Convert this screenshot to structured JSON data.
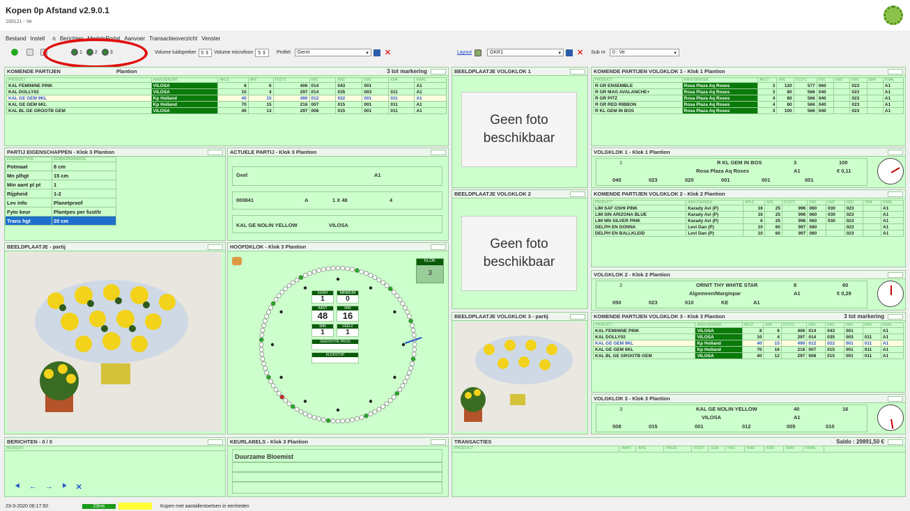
{
  "app": {
    "title": "Kopen 0p Afstand v2.9.0.1",
    "subtitle": "100121 - Ve"
  },
  "menu": [
    "Bestand",
    "Instell",
    "n",
    "Berichten",
    "ModelsPortal",
    "Aanvoer",
    "Transactieoverzicht",
    "Venster"
  ],
  "toolbar": {
    "clock1": "1",
    "clock2": "2",
    "clock3": "3",
    "volume_speaker_label": "Volume luidspreker",
    "volume_speaker": "5",
    "volume_mic_label": "Volume microfoon",
    "volume_mic": "5",
    "profile_label": "Profiel",
    "profile": "Gernt",
    "layout_label": "Layout",
    "layout": "GKR1",
    "sub_label": "Sub nr",
    "sub": "0 : Ve"
  },
  "komende3": {
    "title": "KOMENDE PARTIJEN",
    "title_suffix": "Plantion",
    "marker": "3 tot markering",
    "headers": [
      "PRODUCT",
      "AANVOERDER",
      "APLD",
      "APE",
      "FUSTC",
      "KM1",
      "KM2",
      "KM3",
      "KM4",
      "KWAL"
    ],
    "rows": [
      [
        "KAL FEMININE PINK",
        "VILOSA",
        "8",
        "6",
        "406",
        "014",
        "043",
        "001",
        "",
        "A1"
      ],
      [
        "KAL DOLLY02",
        "VILOSA",
        "10",
        "4",
        "297",
        "014",
        "035",
        "003",
        "011",
        "A1"
      ],
      [
        "KAL GE GEM 9KL",
        "Kp Holland",
        "40",
        "15",
        "490",
        "012",
        "022",
        "001",
        "011",
        "A1"
      ],
      [
        "KAL GE GEM 6KL",
        "Kp Holland",
        "70",
        "15",
        "216",
        "007",
        "015",
        "001",
        "011",
        "A1"
      ],
      [
        "KAL BL GE GROOTB GEM",
        "VILOSA",
        "40",
        "13",
        "297",
        "008",
        "015",
        "001",
        "011",
        "A1"
      ]
    ]
  },
  "beeld1": {
    "title": "BEELDPLAATJE VOLGKLOK 1",
    "text": "Geen foto beschikbaar"
  },
  "beeld2": {
    "title": "BEELDPLAATJE VOLGKLOK 2",
    "text": "Geen foto beschikbaar"
  },
  "beeld3": {
    "title": "BEELDPLAATJE VOLGKLOK 3 - partij"
  },
  "komende1": {
    "title": "KOMENDE PARTIJEN VOLGKLOK 1 - Klok 1 Plantion",
    "headers": [
      "PRODUCT",
      "AANVOERDER",
      "APLD",
      "APE",
      "FUSTC",
      "KM1",
      "KM2",
      "KM3",
      "KM4",
      "KWAL"
    ],
    "rows": [
      [
        "R GR ENSEMBLE",
        "Rosa Plaza Aq Roses",
        "3",
        "120",
        "577",
        "060",
        "",
        "023",
        "",
        "A1"
      ],
      [
        "R GR MAG AVALANCHE+",
        "Rosa Plaza Aq Roses",
        "3",
        "80",
        "566",
        "040",
        "",
        "023",
        "",
        "A1"
      ],
      [
        "R GR PITZ",
        "Rosa Plaza Aq Roses",
        "4",
        "80",
        "566",
        "040",
        "",
        "023",
        "",
        "A1"
      ],
      [
        "R GR RED RIBBON",
        "Rosa Plaza Aq Roses",
        "4",
        "80",
        "566",
        "040",
        "",
        "023",
        "",
        "A1"
      ],
      [
        "R KL GEM IN BOS",
        "Rosa Plaza Aq Roses",
        "3",
        "100",
        "566",
        "040",
        "",
        "023",
        "",
        "A1"
      ]
    ]
  },
  "volg1": {
    "title": "VOLGKLOK 1 - Klok 1 Plantion",
    "nr": "1",
    "product": "R KL GEM IN BOS",
    "aanvoerder": "Rosa Plaza Aq Roses",
    "v1": "3",
    "v2": "100",
    "kwal": "A1",
    "prijs": "€ 0,11",
    "c1": "040",
    "c2": "023",
    "c3": "020",
    "c4": "001",
    "c5": "001",
    "c6": "001"
  },
  "komende2": {
    "title": "KOMENDE PARTIJEN VOLGKLOK 2 - Klok 2 Plantion",
    "headers": [
      "PRODUCT",
      "AANVOERDER",
      "APLD",
      "APE",
      "FUSTC",
      "KM1",
      "KM2",
      "KM3",
      "KM4",
      "KWAL"
    ],
    "rows": [
      [
        "LIM SAF OSHI PINK",
        "Karady Avi (P)",
        "16",
        "25",
        "996",
        "060",
        "030",
        "023",
        "",
        "A1"
      ],
      [
        "LIM SIN ARIZONA BLUE",
        "Karady Avi (P)",
        "16",
        "25",
        "996",
        "060",
        "030",
        "023",
        "",
        "A1"
      ],
      [
        "LIM MN SILVER PINK",
        "Karady Avi (P)",
        "6",
        "25",
        "996",
        "060",
        "030",
        "023",
        "",
        "A1"
      ],
      [
        "DELPH EN DONNA",
        "Levi Dan (P)",
        "10",
        "60",
        "997",
        "080",
        "",
        "023",
        "",
        "A1"
      ],
      [
        "DELPH EN BALLKLEID",
        "Levi Dan (P)",
        "10",
        "60",
        "997",
        "080",
        "",
        "023",
        "",
        "A1"
      ]
    ]
  },
  "volg2": {
    "title": "VOLGKLOK 2 - Klok 2 Plantion",
    "nr": "2",
    "product": "ORNIT THY WHITE STAR",
    "aanvoerder": "Algemeen/Marginpar",
    "v1": "8",
    "v2": "60",
    "kwal": "A1",
    "prijs": "€ 0,29",
    "c1": "050",
    "c2": "023",
    "c3": "010",
    "c4": "KE",
    "c5": "A1"
  },
  "komende3b": {
    "title": "KOMENDE PARTIJEN VOLGKLOK 3 - Klok 3 Plantion",
    "marker": "3 tot markering",
    "headers": [
      "PRODUCT",
      "AANVOERDER",
      "APLD",
      "APE",
      "FUSTC",
      "KM1",
      "KM2",
      "KM3",
      "KM4",
      "KWAL"
    ],
    "rows": [
      [
        "KAL FEMININE PINK",
        "VILOSA",
        "8",
        "6",
        "406",
        "014",
        "043",
        "001",
        "",
        "A1"
      ],
      [
        "KAL DOLLY02",
        "VILOSA",
        "10",
        "4",
        "297",
        "014",
        "035",
        "003",
        "011",
        "A1"
      ],
      [
        "KAL GE GEM 9KL",
        "Kp Holland",
        "40",
        "15",
        "490",
        "012",
        "022",
        "001",
        "011",
        "A1"
      ],
      [
        "KAL GE GEM 6KL",
        "Kp Holland",
        "70",
        "16",
        "216",
        "007",
        "015",
        "001",
        "011",
        "A1"
      ],
      [
        "KAL BL GE GROOTB GEM",
        "VILOSA",
        "40",
        "12",
        "297",
        "008",
        "015",
        "001",
        "011",
        "A1"
      ]
    ]
  },
  "volg3": {
    "title": "VOLGKLOK 3 - Klok 3 Plantion",
    "nr": "3",
    "product": "KAL GE NOLIN YELLOW",
    "aanvoerder": "VILOSA",
    "v1": "40",
    "v2": "16",
    "kwal": "A1",
    "c1": "008",
    "c2": "015",
    "c3": "001",
    "c4": "012",
    "c5": "005",
    "c6": "010"
  },
  "eigen": {
    "title": "PARTIJ EIGENSCHAPPEN - Klok 3 Plantion",
    "headers": [
      "KENMERKTYPE",
      "KENMERKWAARDE"
    ],
    "rows": [
      [
        "Potmaat",
        "8 cm"
      ],
      [
        "Mn plhgt",
        "15 cm"
      ],
      [
        "Min aant pl pt",
        "1"
      ],
      [
        "Rijpheid",
        "1-2"
      ],
      [
        "Lev info",
        "Planetproof"
      ],
      [
        "Fyto keur",
        "Plantpes per fust/tr"
      ],
      [
        "Trans hgt",
        "20 cm"
      ]
    ]
  },
  "actueel": {
    "title": "ACTUELE PARTIJ - Klok 3 Plantion",
    "kleur": "Geel",
    "kwal": "A1",
    "nr": "000841",
    "a": "A",
    "fust": "1 X 48",
    "b": "4",
    "product": "KAL GE NOLIN YELLOW",
    "aanvoerder": "VILOSA"
  },
  "beeldpartij": {
    "title": "BEELDPLAATJE - partij"
  },
  "hoofdklok": {
    "title": "HOOFDKLOK - Klok 3 Plantion",
    "klok_label": "KLOK",
    "klok": "3",
    "l1": "EENH",
    "l2": "MINIMUM",
    "v1": "1",
    "v2": "0",
    "l3": "AANT",
    "l4": "MIN",
    "v3": "48",
    "v4": "16",
    "l5": "MIN",
    "l6": "VEELV",
    "v5": "1",
    "v6": "1",
    "l7": "GEKOCHTE PRIJS",
    "l8": "KLOKSTOP"
  },
  "berichten": {
    "title": "BERICHTEN - 0 / 0",
    "header": "BERICHT"
  },
  "keur": {
    "title": "KEURLABELS - Klok 3 Plantion",
    "label": "Duurzame Bloemist"
  },
  "trans": {
    "title": "TRANSACTIES",
    "saldo": "Saldo : 29891,50 €",
    "headers": [
      "PRODUCT",
      "AANT",
      "APE",
      "PRIJS",
      "FUST",
      "SUB",
      "KM1",
      "KM2",
      "KM3",
      "KM4",
      "KWAL"
    ]
  },
  "status": {
    "datetime": "23-3-2020 06:17:50",
    "ms": "23ms",
    "msg": "Kopen met aantallentoetsen in eenheden"
  },
  "colors": {
    "panel": "#ccffcc",
    "dark_green": "#0a7a0a",
    "selected": "#fffde0"
  }
}
